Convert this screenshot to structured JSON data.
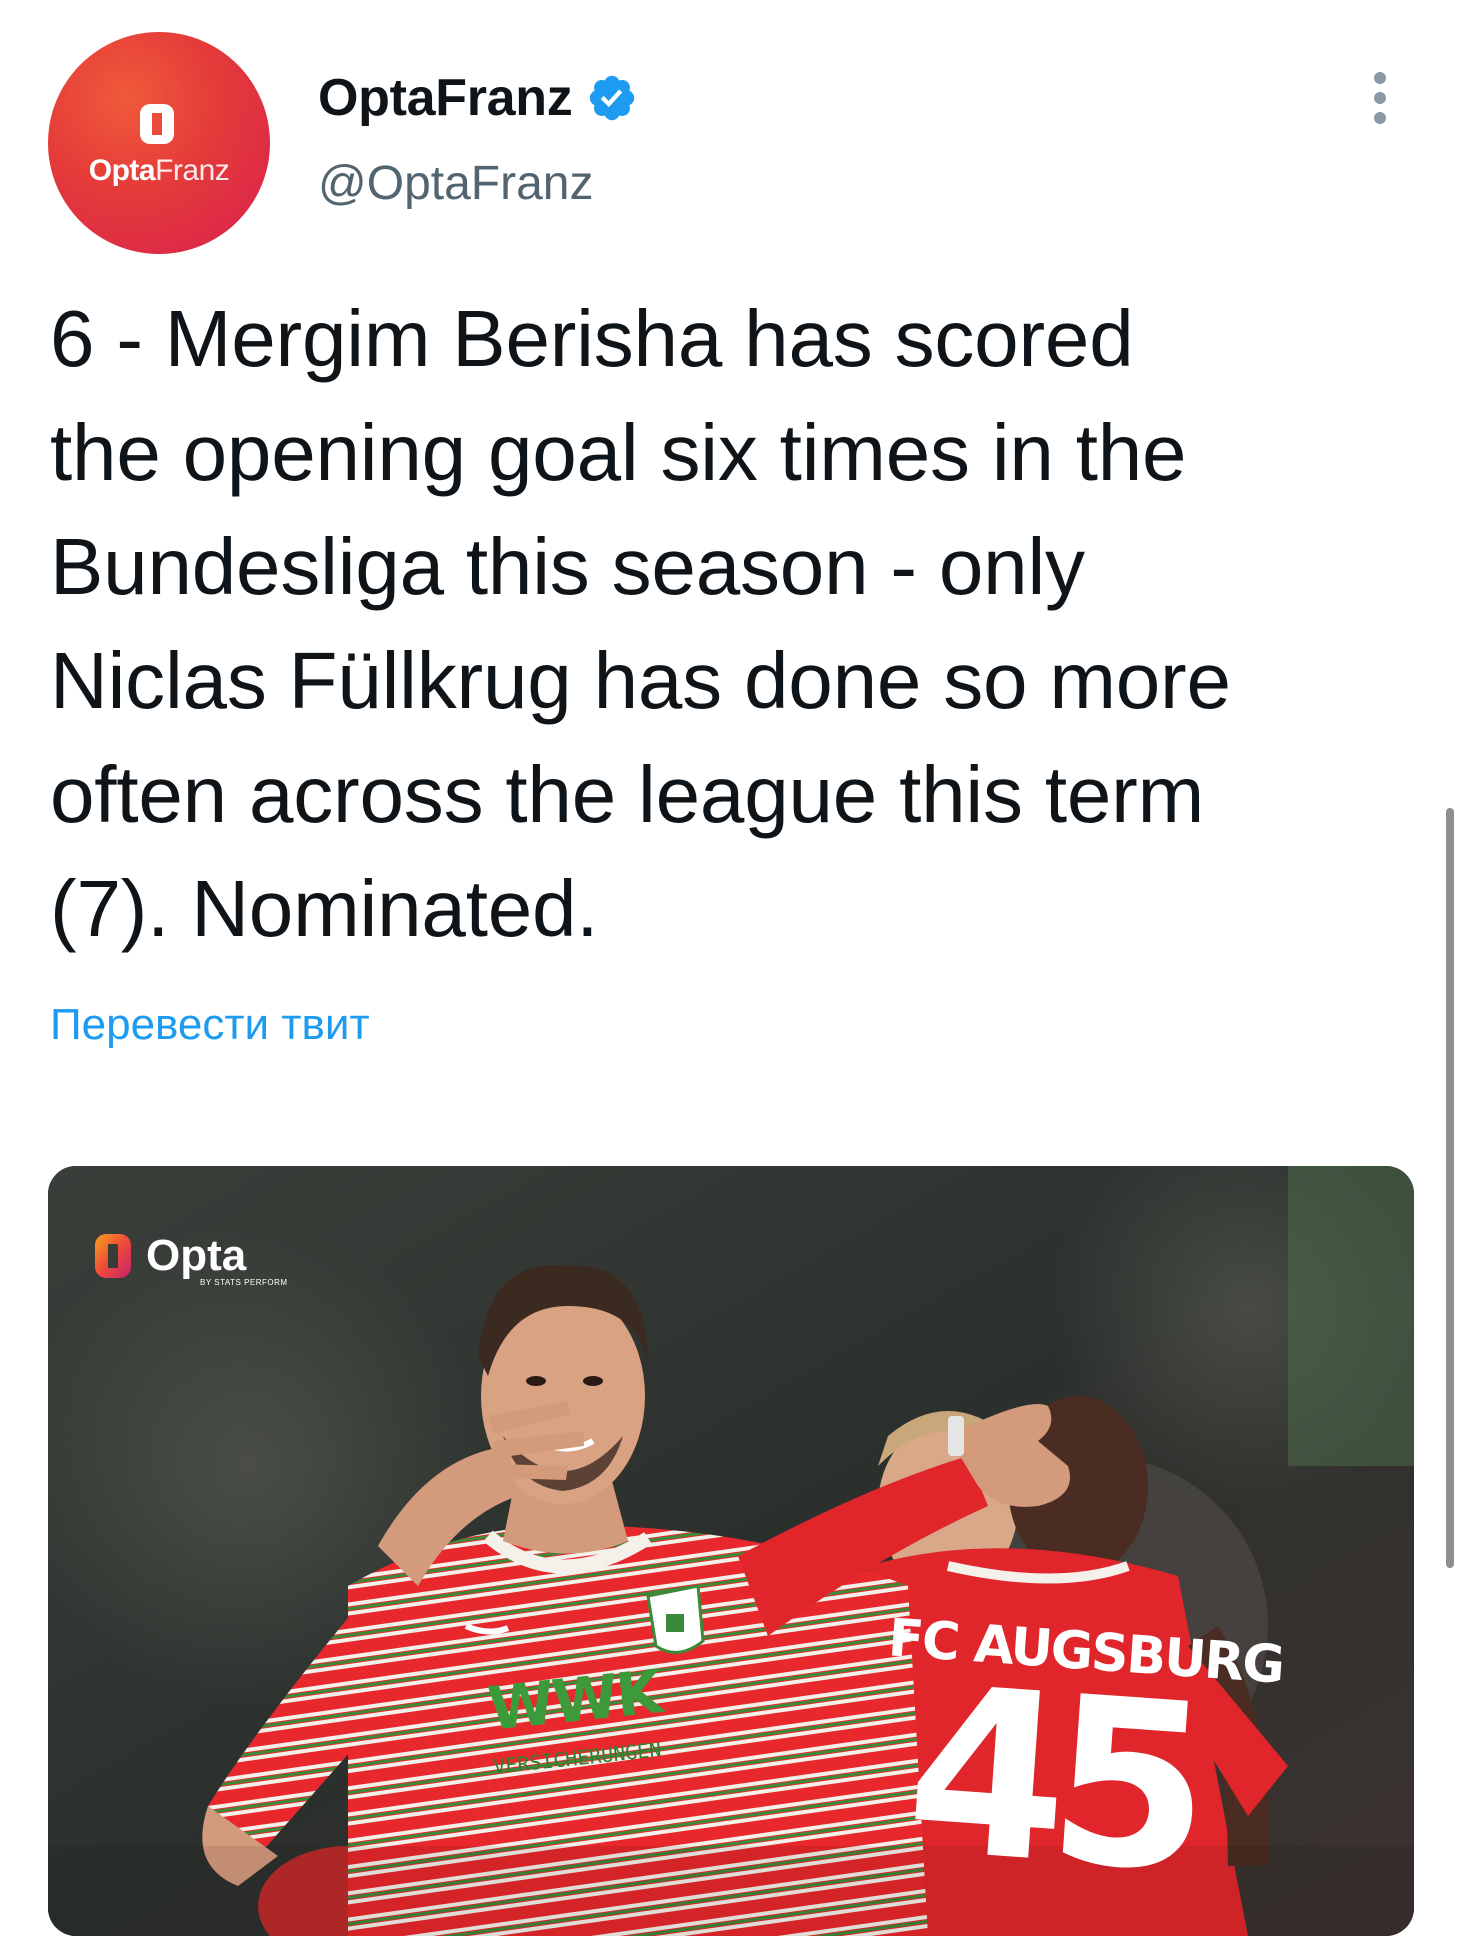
{
  "tweet": {
    "author": {
      "display_name": "OptaFranz",
      "handle": "@OptaFranz",
      "verified": true,
      "avatar_logo_bold": "Opta",
      "avatar_logo_light": "Franz"
    },
    "text": "6 - Mergim Berisha has scored\nthe opening goal six times in the\nBundesliga this season - only\nNiclas Füllkrug has done so more\noften across the league this term\n(7). Nominated.",
    "translate_label": "Перевести твит",
    "more_icon": "more-vertical-icon"
  },
  "media": {
    "watermark_word": "Opta",
    "watermark_sub": "BY STATS PERFORM",
    "sponsor_main": "WWK",
    "sponsor_sub": "VERSICHERUNGEN",
    "back_name": "FC AUGSBURG",
    "back_number": "45"
  },
  "colors": {
    "accent": "#1d9bf0",
    "avatar_red": "#e43a3a",
    "secondary_text": "#536471"
  }
}
